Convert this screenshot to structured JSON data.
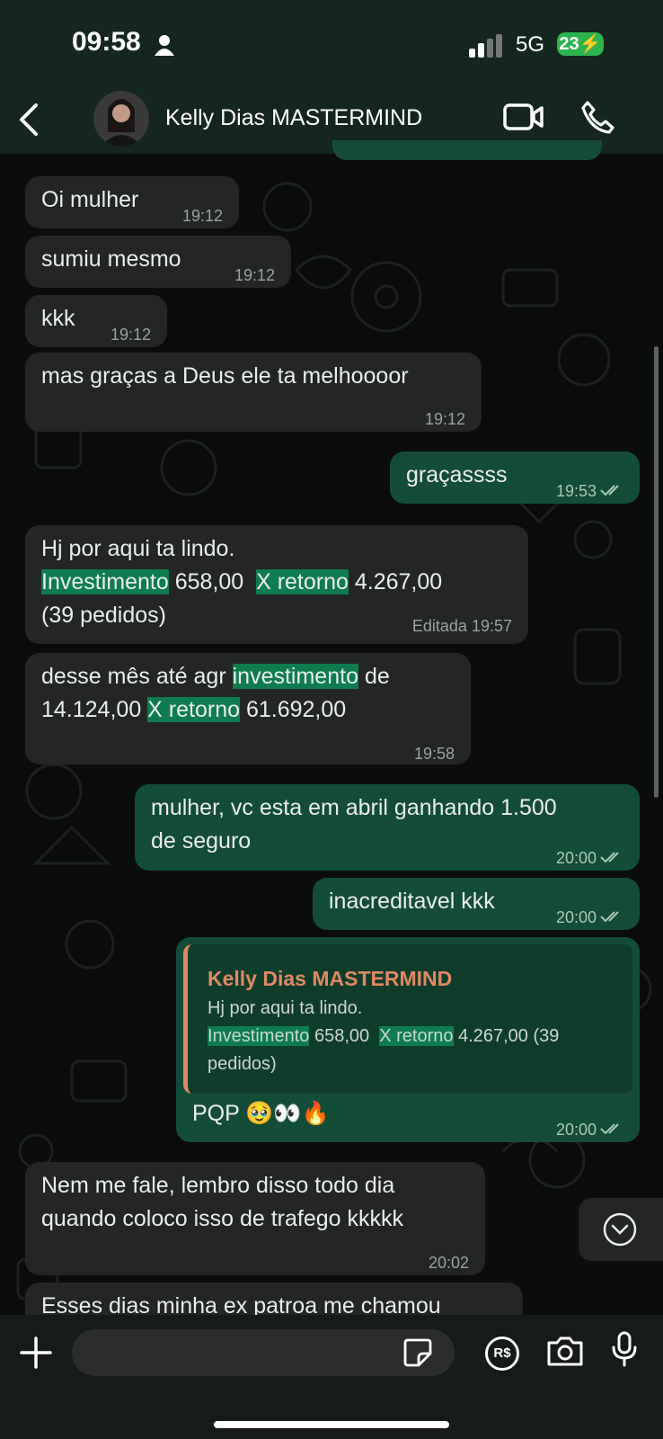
{
  "status_bar": {
    "time": "09:58",
    "network": "5G",
    "battery": "23"
  },
  "header": {
    "contact_name": "Kelly Dias MASTERMIND"
  },
  "messages": [
    {
      "text": "Oi mulher",
      "time": "19:12"
    },
    {
      "text": "sumiu mesmo",
      "time": "19:12"
    },
    {
      "text": "kkk",
      "time": "19:12"
    },
    {
      "text": "mas graças a Deus ele ta melhoooor",
      "time": "19:12"
    },
    {
      "text": "graçassss",
      "time": "19:53"
    },
    {
      "line1": "Hj por aqui ta lindo.",
      "hl_investimento": "Investimento",
      "v1": "658,00",
      "hl_retorno": "X retorno",
      "v2": "4.267,00",
      "line3": "(39 pedidos)",
      "edited": "Editada",
      "time": "19:57"
    },
    {
      "pre": "desse mês até agr",
      "hl_investimento": "investimento",
      "de": "de",
      "v1": "14.124,00",
      "hl_retorno": "X retorno",
      "v2": "61.692,00",
      "time": "19:58"
    },
    {
      "line1": "mulher, vc esta em abril ganhando 1.500",
      "line2": "de seguro",
      "time": "20:00"
    },
    {
      "text": "inacreditavel kkk",
      "time": "20:00"
    },
    {
      "quote_name": "Kelly Dias MASTERMIND",
      "quote_line1": "Hj por aqui ta lindo.",
      "quote_hl1": "Investimento",
      "quote_v1": "658,00",
      "quote_hl2": "X retorno",
      "quote_v2": "4.267,00 (39",
      "quote_line3": "pedidos)",
      "text": "PQP 🥹👀🔥",
      "time": "20:00"
    },
    {
      "line1": "Nem me fale, lembro disso todo dia",
      "line2": "quando coloco isso de trafego kkkkk",
      "time": "20:02"
    },
    {
      "text": "Esses dias minha ex patroa me chamou"
    }
  ],
  "footer": {
    "currency_icon_label": "R$"
  },
  "colors": {
    "outgoing": "#134d37",
    "incoming": "#242626",
    "highlight": "#0e7c4f",
    "quote_accent": "#e08864"
  }
}
